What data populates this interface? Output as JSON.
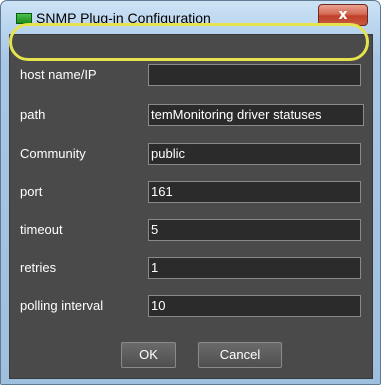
{
  "window": {
    "title": "SNMP Plug-in Configuration",
    "icon": "green-app-icon",
    "close_label": "x"
  },
  "fields": [
    {
      "label": "host name/IP",
      "value": ""
    },
    {
      "label": "path",
      "value": "temMonitoring driver statuses"
    },
    {
      "label": "Community",
      "value": "public"
    },
    {
      "label": "port",
      "value": "161"
    },
    {
      "label": "timeout",
      "value": "5"
    },
    {
      "label": "retries",
      "value": "1"
    },
    {
      "label": "polling interval",
      "value": "10"
    }
  ],
  "buttons": {
    "ok": "OK",
    "cancel": "Cancel"
  },
  "colors": {
    "panel_bg": "#4a4a4a",
    "field_bg": "#2b2b2b",
    "highlight": "#e6e34d",
    "close_button": "#c85a40"
  }
}
